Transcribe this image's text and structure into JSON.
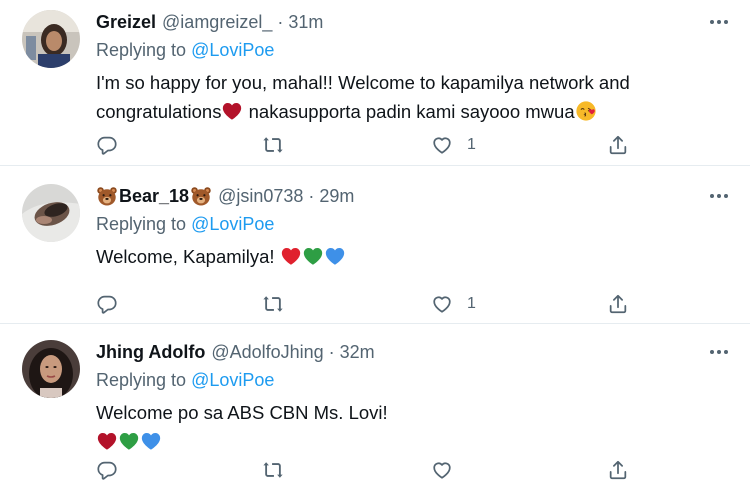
{
  "tweets": [
    {
      "name": "Greizel",
      "handle": "@iamgreizel_",
      "separator": "·",
      "time": "31m",
      "replying_prefix": "Replying to",
      "replying_to": "@LoviPoe",
      "text_line1": "I'm so happy for you, mahal!! Welcome to kapamilya network and",
      "text_line2_a": "congratulations",
      "text_line2_b": "nakasupporta padin kami sayooo mwua",
      "like_count": "1"
    },
    {
      "name": "Bear_18",
      "handle": "@jsin0738",
      "separator": "·",
      "time": "29m",
      "replying_prefix": "Replying to",
      "replying_to": "@LoviPoe",
      "text": "Welcome, Kapamilya!",
      "like_count": "1"
    },
    {
      "name": "Jhing Adolfo",
      "handle": "@AdolfoJhing",
      "separator": "·",
      "time": "32m",
      "replying_prefix": "Replying to",
      "replying_to": "@LoviPoe",
      "text": "Welcome po sa ABS CBN Ms. Lovi!",
      "like_count": ""
    }
  ],
  "icons": {
    "reply": "reply-icon",
    "retweet": "retweet-icon",
    "like": "heart-icon",
    "share": "share-icon",
    "more": "more-options-icon",
    "bear": "bear-face-emoji",
    "red_heart": "red-heart-emoji",
    "green_heart": "green-heart-emoji",
    "blue_heart": "blue-heart-emoji",
    "kiss": "face-blowing-kiss-emoji"
  },
  "colors": {
    "mention": "#1d9bf0",
    "secondary_text": "#536471",
    "red_heart": "#c8102e",
    "green_heart": "#2e9e44",
    "blue_heart": "#3e90e8"
  }
}
